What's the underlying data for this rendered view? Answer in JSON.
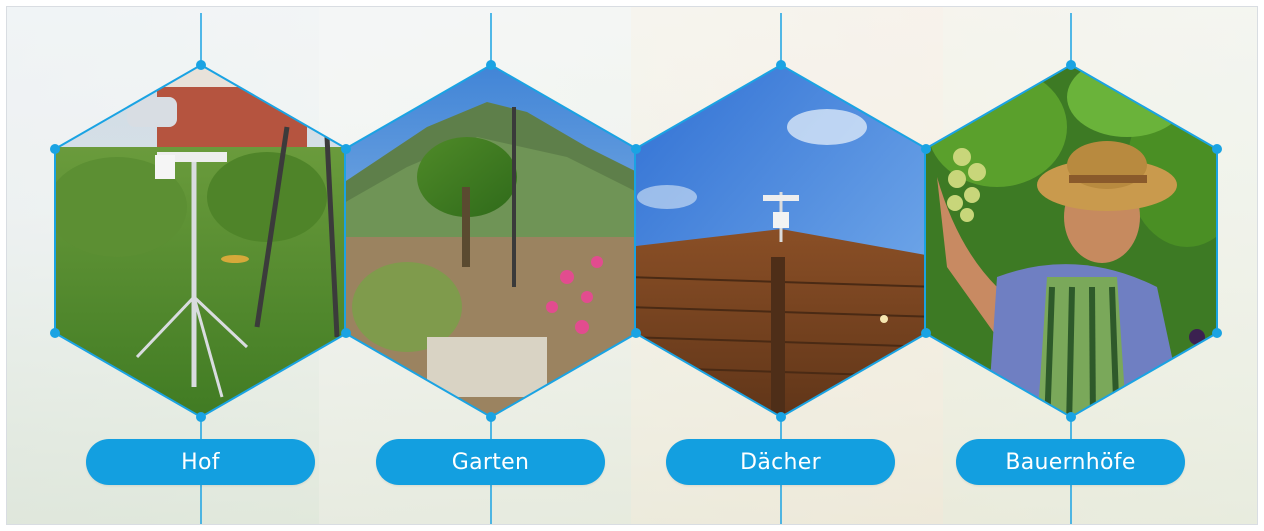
{
  "locations": [
    {
      "label": "Hof",
      "icon": "weather-station-yard-photo"
    },
    {
      "label": "Garten",
      "icon": "weather-station-garden-photo"
    },
    {
      "label": "Dächer",
      "icon": "weather-station-roof-photo"
    },
    {
      "label": "Bauernhöfe",
      "icon": "farmer-grapes-photo"
    }
  ],
  "colors": {
    "accent": "#139fe0",
    "line": "#1aa3e3"
  }
}
